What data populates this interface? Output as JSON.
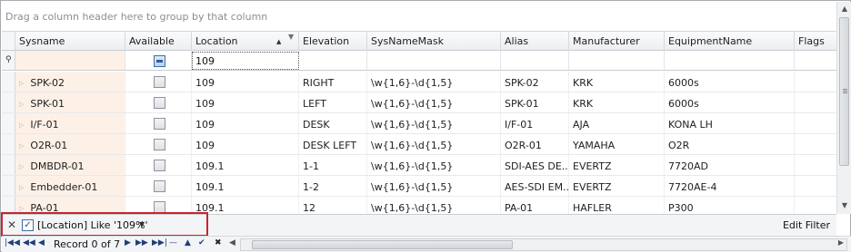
{
  "group_panel_text": "Drag a column header here to group by that column",
  "columns": [
    {
      "label": "Sysname"
    },
    {
      "label": "Available"
    },
    {
      "label": "Location"
    },
    {
      "label": "Elevation"
    },
    {
      "label": "SysNameMask"
    },
    {
      "label": "Alias"
    },
    {
      "label": "Manufacturer"
    },
    {
      "label": "EquipmentName"
    },
    {
      "label": "Flags"
    }
  ],
  "filter_row": {
    "location_value": "109"
  },
  "rows": [
    {
      "sysname": "SPK-02",
      "location": "109",
      "elevation": "RIGHT",
      "mask": "\\w{1,6}-\\d{1,5}",
      "alias": "SPK-02",
      "manufacturer": "KRK",
      "equipment": "6000s"
    },
    {
      "sysname": "SPK-01",
      "location": "109",
      "elevation": "LEFT",
      "mask": "\\w{1,6}-\\d{1,5}",
      "alias": "SPK-01",
      "manufacturer": "KRK",
      "equipment": "6000s"
    },
    {
      "sysname": "I/F-01",
      "location": "109",
      "elevation": "DESK",
      "mask": "\\w{1,6}-\\d{1,5}",
      "alias": "I/F-01",
      "manufacturer": "AJA",
      "equipment": "KONA LH"
    },
    {
      "sysname": "O2R-01",
      "location": "109",
      "elevation": "DESK LEFT",
      "mask": "\\w{1,6}-\\d{1,5}",
      "alias": "O2R-01",
      "manufacturer": "YAMAHA",
      "equipment": "O2R"
    },
    {
      "sysname": "DMBDR-01",
      "location": "109.1",
      "elevation": "1-1",
      "mask": "\\w{1,6}-\\d{1,5}",
      "alias": "SDI-AES DE...",
      "manufacturer": "EVERTZ",
      "equipment": "7720AD"
    },
    {
      "sysname": "Embedder-01",
      "location": "109.1",
      "elevation": "1-2",
      "mask": "\\w{1,6}-\\d{1,5}",
      "alias": "AES-SDI EM...",
      "manufacturer": "EVERTZ",
      "equipment": "7720AE-4"
    },
    {
      "sysname": "PA-01",
      "location": "109.1",
      "elevation": "12",
      "mask": "\\w{1,6}-\\d{1,5}",
      "alias": "PA-01",
      "manufacturer": "HAFLER",
      "equipment": "P300"
    }
  ],
  "filter_panel": {
    "expression": "[Location] Like '109%'",
    "edit_label": "Edit Filter"
  },
  "navigator": {
    "record_text": "Record 0 of 7"
  },
  "colors": {
    "sysname_cell_bg": "#fdf1e7",
    "highlight_border": "#c7252c"
  }
}
